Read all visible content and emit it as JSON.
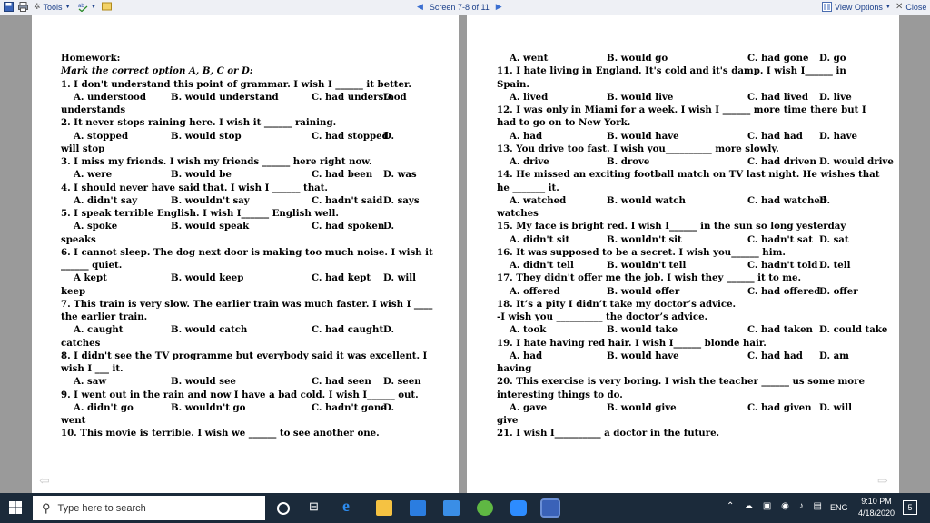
{
  "toolbar": {
    "tools_label": "Tools",
    "screen_label": "Screen 7-8 of 11",
    "view_options_label": "View Options",
    "close_label": "Close"
  },
  "left_page": {
    "title": "Homework:",
    "instruction": "Mark the correct option A, B, C or D:",
    "lines": [
      {
        "t": "1. I don't understand this point of grammar. I wish I ______ it better."
      },
      {
        "opts": [
          "A. understood",
          "B. would understand",
          "C. had understood",
          "D."
        ]
      },
      {
        "t": "understands"
      },
      {
        "t": "2. It never stops raining here. I wish it ______ raining."
      },
      {
        "opts": [
          "A. stopped",
          "B. would stop",
          "C. had stopped",
          "D."
        ]
      },
      {
        "t": "will stop"
      },
      {
        "t": "3. I miss my friends. I wish my friends ______ here right now."
      },
      {
        "opts": [
          "A. were",
          "B. would be",
          "C. had been",
          "D. was"
        ]
      },
      {
        "t": "4. I should never have said that. I wish I ______ that."
      },
      {
        "opts": [
          "A. didn't say",
          "B. wouldn't say",
          "C. hadn't said",
          "D. says"
        ]
      },
      {
        "t": "5. I speak terrible English. I wish I______ English well."
      },
      {
        "opts": [
          "A. spoke",
          "B. would speak",
          "C. had spoken",
          "D."
        ]
      },
      {
        "t": "speaks"
      },
      {
        "t": "6. I cannot sleep. The dog next door is making too much noise. I wish it"
      },
      {
        "t": "______ quiet."
      },
      {
        "opts": [
          "A kept",
          "B. would keep",
          "C. had kept",
          "D. will"
        ]
      },
      {
        "t": "keep"
      },
      {
        "t": "7. This train is very slow. The earlier train was much faster. I wish I ____"
      },
      {
        "t": "the earlier train."
      },
      {
        "opts": [
          "A. caught",
          "B. would catch",
          "C. had caught",
          "D."
        ]
      },
      {
        "t": "catches"
      },
      {
        "t": "8. I didn't see the TV programme but everybody said it was excellent. I"
      },
      {
        "t": "wish I ___ it."
      },
      {
        "opts": [
          "A. saw",
          "B. would see",
          "C. had seen",
          "D. seen"
        ]
      },
      {
        "t": "9. I went out in the rain and now I have a bad cold. I wish I______ out."
      },
      {
        "opts": [
          "A. didn't go",
          "B. wouldn't go",
          "C. hadn't gone",
          "D."
        ]
      },
      {
        "t": "went"
      },
      {
        "t": "10. This movie is terrible. I wish we ______ to see another one."
      }
    ]
  },
  "right_page": {
    "lines": [
      {
        "opts": [
          "A. went",
          "B. would go",
          "C. had gone",
          "D. go"
        ]
      },
      {
        "t": "11. I hate living in England. It's cold and it's damp. I wish I______ in"
      },
      {
        "t": "Spain."
      },
      {
        "opts": [
          "A. lived",
          "B. would live",
          "C. had lived",
          "D. live"
        ]
      },
      {
        "t": "12.  I was only in Miami for a week. I wish I ______ more time there but I"
      },
      {
        "t": "had to go on to New York."
      },
      {
        "opts": [
          "A. had",
          "B. would have",
          "C. had had",
          "D. have"
        ]
      },
      {
        "t": "13. You drive too fast. I wish you__________ more slowly."
      },
      {
        "opts": [
          "A. drive",
          "B. drove",
          "C. had driven",
          "D. would drive"
        ]
      },
      {
        "t": "14. He missed an exciting football match on TV last night. He wishes that"
      },
      {
        "t": "he _______ it."
      },
      {
        "opts": [
          "A. watched",
          "B. would watch",
          "C. had watched",
          "D."
        ]
      },
      {
        "t": "watches"
      },
      {
        "t": "15. My face is bright red. I wish I______ in the sun so long yesterday"
      },
      {
        "opts": [
          "A. didn't sit",
          "B. wouldn't sit",
          "C. hadn't sat",
          "D. sat"
        ]
      },
      {
        "t": "16. It was supposed to be a secret. I wish you______ him."
      },
      {
        "opts": [
          "A. didn't tell",
          "B. wouldn't tell",
          "C. hadn't told",
          "D. tell"
        ]
      },
      {
        "t": "17. They didn't offer me the job. I wish they ______ it to me."
      },
      {
        "opts": [
          "A. offered",
          "B. would offer",
          "C. had offered",
          "D. offer"
        ]
      },
      {
        "t": "18.  It’s a pity I didn’t take my doctor’s advice."
      },
      {
        "t": "-I wish you __________ the doctor’s advice."
      },
      {
        "opts": [
          "A. took",
          "B. would take",
          "C. had taken",
          "D. could take"
        ]
      },
      {
        "t": "19. I hate having red hair. I wish I______ blonde hair."
      },
      {
        "opts": [
          "A. had",
          "B. would have",
          "C. had had",
          "D. am"
        ]
      },
      {
        "t": "having"
      },
      {
        "t": "20. This exercise is very boring. I wish the teacher ______ us some more"
      },
      {
        "t": "interesting things to do."
      },
      {
        "opts": [
          "A. gave",
          "B. would give",
          "C. had given",
          "D. will"
        ]
      },
      {
        "t": "give"
      },
      {
        "t": "21.  I wish I__________ a doctor in the future."
      }
    ]
  },
  "taskbar": {
    "search_placeholder": "Type here to search",
    "language": "ENG",
    "time": "9:10 PM",
    "date": "4/18/2020",
    "notification_count": "5"
  }
}
